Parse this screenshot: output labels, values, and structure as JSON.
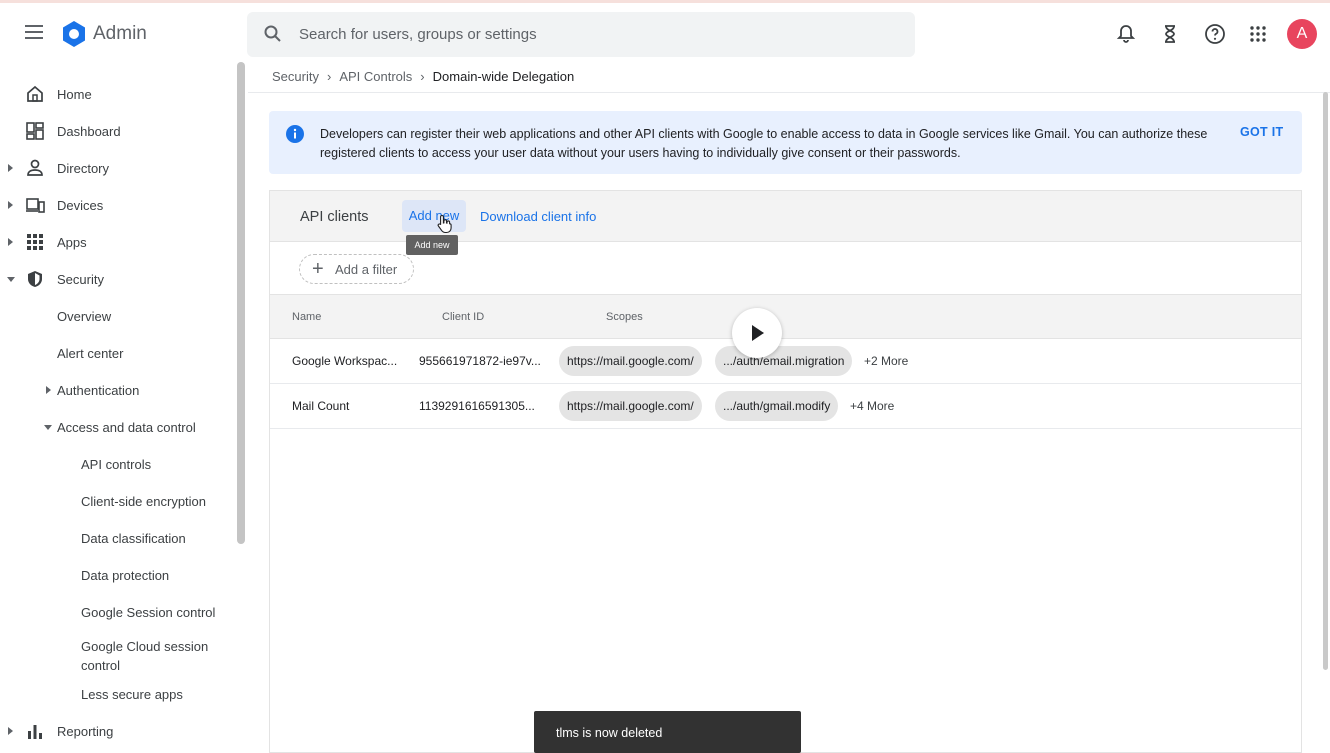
{
  "app": {
    "title": "Admin"
  },
  "search": {
    "placeholder": "Search for users, groups or settings"
  },
  "avatar": {
    "initial": "A"
  },
  "colors": {
    "accent": "#1a73e8",
    "avatar": "#e8455e",
    "banner": "#e8f0fe"
  },
  "sidebar": {
    "items": [
      {
        "label": "Home",
        "icon": "home-icon"
      },
      {
        "label": "Dashboard",
        "icon": "dashboard-icon"
      },
      {
        "label": "Directory",
        "icon": "person-icon"
      },
      {
        "label": "Devices",
        "icon": "devices-icon"
      },
      {
        "label": "Apps",
        "icon": "apps-grid-icon"
      },
      {
        "label": "Security",
        "icon": "shield-icon"
      },
      {
        "label": "Overview"
      },
      {
        "label": "Alert center"
      },
      {
        "label": "Authentication"
      },
      {
        "label": "Access and data control"
      },
      {
        "label": "API controls"
      },
      {
        "label": "Client-side encryption"
      },
      {
        "label": "Data classification"
      },
      {
        "label": "Data protection"
      },
      {
        "label": "Google Session control"
      },
      {
        "label": "Google Cloud session control"
      },
      {
        "label": "Less secure apps"
      },
      {
        "label": "Reporting",
        "icon": "bar-chart-icon"
      }
    ]
  },
  "breadcrumb": {
    "items": [
      "Security",
      "API Controls",
      "Domain-wide Delegation"
    ]
  },
  "banner": {
    "text": "Developers can register their web applications and other API clients with Google to enable access to data in Google services like Gmail. You can authorize these registered clients to access your user data without your users having to individually give consent or their passwords.",
    "action": "GOT IT"
  },
  "card": {
    "title": "API clients",
    "add_label": "Add new",
    "download_label": "Download client info",
    "tooltip": "Add new",
    "filter_label": "Add a filter"
  },
  "table": {
    "headers": [
      "Name",
      "Client ID",
      "Scopes"
    ],
    "rows": [
      {
        "name": "Google Workspac...",
        "client_id": "955661971872-ie97v...",
        "scope1": "https://mail.google.com/",
        "scope2": ".../auth/email.migration",
        "more": "+2 More"
      },
      {
        "name": "Mail Count",
        "client_id": "1139291616591305...",
        "scope1": "https://mail.google.com/",
        "scope2": ".../auth/gmail.modify",
        "more": "+4 More"
      }
    ]
  },
  "snackbar": {
    "message": "tlms is now deleted"
  }
}
